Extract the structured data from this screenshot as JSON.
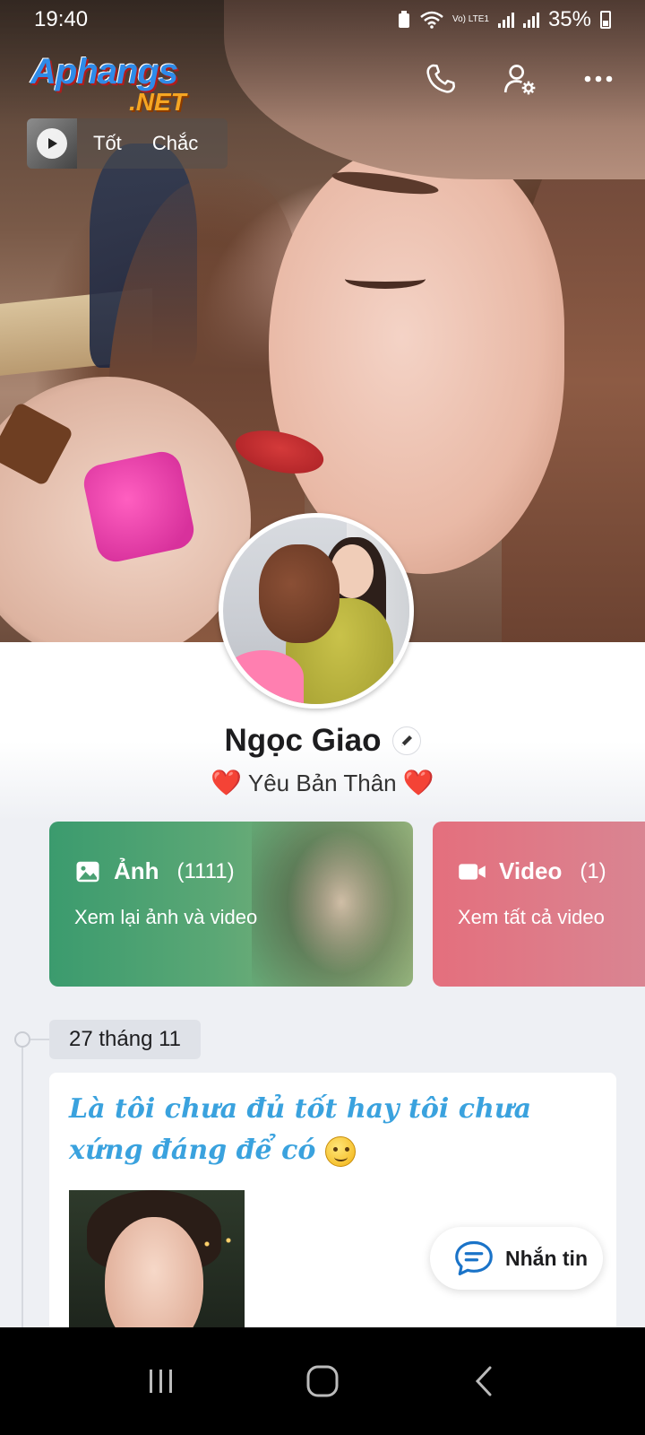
{
  "status_bar": {
    "time": "19:40",
    "network": "Vo) LTE1",
    "battery": "35%"
  },
  "watermark": {
    "brand": "Aphangs",
    "suffix": ".NET"
  },
  "top_actions": {
    "icons": [
      "phone-icon",
      "user-settings-icon",
      "more-icon"
    ]
  },
  "music": {
    "title": "Tốt Chắc"
  },
  "profile": {
    "name": "Ngọc Giao",
    "bio_text": "Yêu Bản Thân",
    "bio_emoji": "❤️"
  },
  "media_cards": {
    "photos": {
      "title": "Ảnh",
      "count": "(1111)",
      "subtitle": "Xem lại ảnh và video",
      "icon": "image-icon",
      "color": "#3b9b6e"
    },
    "videos": {
      "title": "Video",
      "count": "(1)",
      "subtitle": "Xem tất cả video",
      "icon": "video-icon",
      "color": "#e46f7d"
    }
  },
  "timeline": {
    "date": "27 tháng 11",
    "post_text": "Là tôi chưa đủ tốt hay tôi chưa xứng đáng để có"
  },
  "chat_button": {
    "label": "Nhắn tin",
    "icon": "chat-bubble-icon",
    "accent": "#1a73c8"
  },
  "nav_bar": {
    "icons": [
      "recent-apps-icon",
      "home-icon",
      "back-icon"
    ]
  }
}
